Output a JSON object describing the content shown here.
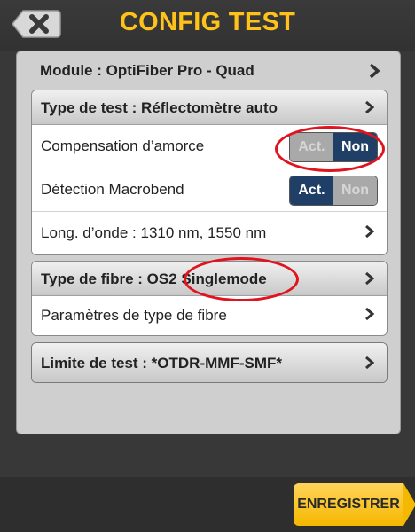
{
  "header": {
    "title": "CONFIG TEST",
    "back_icon": "back-x-icon"
  },
  "module": {
    "label": "Module : OptiFiber Pro - Quad"
  },
  "test_group": {
    "heading": "Type de test : Réflectomètre auto",
    "rows": [
      {
        "label": "Compensation d’amorce",
        "on_label": "Act.",
        "off_label": "Non",
        "state": "Non"
      },
      {
        "label": "Détection Macrobend",
        "on_label": "Act.",
        "off_label": "Non",
        "state": "Act."
      },
      {
        "label": "Long. d’onde : 1310 nm, 1550 nm"
      }
    ]
  },
  "fiber_group": {
    "heading": "Type de fibre : OS2 Singlemode",
    "rows": [
      {
        "label": "Paramètres de type de fibre"
      }
    ]
  },
  "limit_group": {
    "heading": "Limite de test : *OTDR-MMF-SMF*"
  },
  "footer": {
    "save_label": "ENREGISTRER"
  },
  "colors": {
    "accent": "#ffc21a",
    "toggle_active": "#1f3f66",
    "toggle_inactive": "#a9a9a9",
    "highlight": "#e0141e",
    "save_button": "#f5b800"
  }
}
